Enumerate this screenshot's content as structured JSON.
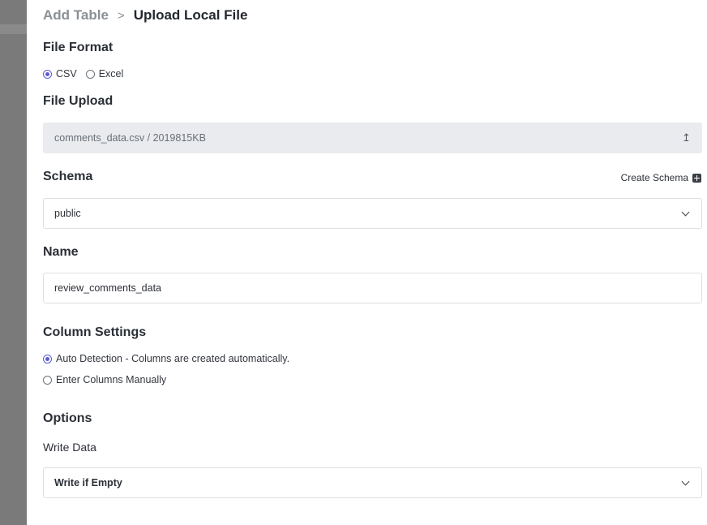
{
  "breadcrumb": {
    "parent": "Add Table",
    "separator": ">",
    "current": "Upload Local File"
  },
  "file_format": {
    "title": "File Format",
    "options": [
      {
        "label": "CSV",
        "checked": true
      },
      {
        "label": "Excel",
        "checked": false
      }
    ]
  },
  "file_upload": {
    "title": "File Upload",
    "value": "comments_data.csv / 2019815KB",
    "icon": "upload-icon"
  },
  "schema": {
    "title": "Schema",
    "create_label": "Create Schema",
    "create_icon": "plus-square-icon",
    "selected": "public"
  },
  "name": {
    "title": "Name",
    "value": "review_comments_data"
  },
  "column_settings": {
    "title": "Column Settings",
    "options": [
      {
        "label": "Auto Detection - Columns are created automatically.",
        "checked": true
      },
      {
        "label": "Enter Columns Manually",
        "checked": false
      }
    ]
  },
  "options": {
    "title": "Options",
    "write_data_label": "Write Data",
    "write_data_selected": "Write if Empty"
  },
  "colors": {
    "accent": "#5b5bd6",
    "upload_bg": "#e9ebee",
    "backdrop": "#7a7a7a"
  }
}
